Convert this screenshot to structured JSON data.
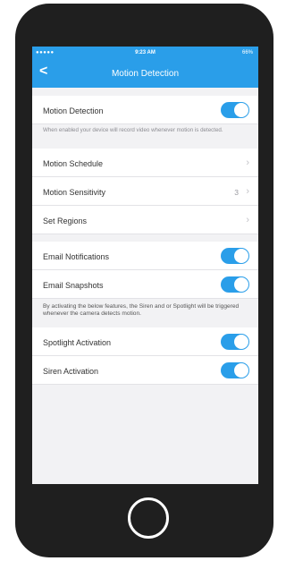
{
  "status": {
    "signal": "●●●●● ",
    "time": "9:23 AM",
    "battery": "66%"
  },
  "nav": {
    "back": "<",
    "title": "Motion Detection"
  },
  "rows": {
    "motion_detection": "Motion Detection",
    "motion_note": "When enabled your device will record video whenever motion is detected.",
    "motion_schedule": "Motion Schedule",
    "motion_sensitivity": "Motion Sensitivity",
    "motion_sensitivity_value": "3",
    "set_regions": "Set Regions",
    "email_notifications": "Email Notifications",
    "email_snapshots": "Email Snapshots",
    "feature_note": "By activating the below features, the Siren and or Spotlight will be triggered whenever the camera detects motion.",
    "spotlight_activation": "Spotlight Activation",
    "siren_activation": "Siren Activation"
  },
  "toggles": {
    "motion_detection": true,
    "email_notifications": true,
    "email_snapshots": true,
    "spotlight_activation": true,
    "siren_activation": true
  },
  "icons": [
    "back-chevron-icon",
    "chevron-right-icon",
    "wifi-icon",
    "battery-icon",
    "home-button-icon"
  ],
  "colors": {
    "accent": "#2a9ee9",
    "background": "#f2f2f4",
    "device": "#1f1f1f"
  }
}
